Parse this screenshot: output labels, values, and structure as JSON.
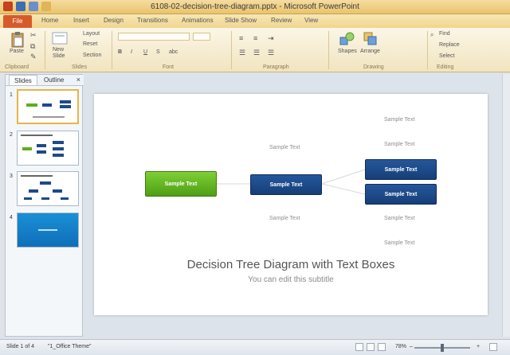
{
  "window": {
    "title": "6108-02-decision-tree-diagram.pptx - Microsoft PowerPoint"
  },
  "ribbon_tabs": [
    "File",
    "Home",
    "Insert",
    "Design",
    "Transitions",
    "Animations",
    "Slide Show",
    "Review",
    "View"
  ],
  "ribbon": {
    "paste": "Paste",
    "new_slide_line1": "New",
    "new_slide_line2": "Slide",
    "layout": "Layout",
    "reset": "Reset",
    "section": "Section",
    "shapes": "Shapes",
    "arrange": "Arrange",
    "find": "Find",
    "replace": "Replace",
    "select": "Select",
    "groups": {
      "clipboard": "Clipboard",
      "slides": "Slides",
      "font": "Font",
      "paragraph": "Paragraph",
      "drawing": "Drawing",
      "editing": "Editing"
    }
  },
  "panel": {
    "tab_slides": "Slides",
    "tab_outline": "Outline",
    "close": "×",
    "slide_numbers": [
      "1",
      "2",
      "3",
      "4"
    ]
  },
  "slide": {
    "root_box": "Sample Text",
    "mid_box": "Sample Text",
    "upper_label": "Sample Text",
    "lower_label": "Sample Text",
    "right_box_1": "Sample Text",
    "right_box_2": "Sample Text",
    "right_text_1": "Sample Text",
    "right_text_2": "Sample Text",
    "right_text_3": "Sample Text",
    "right_text_4": "Sample Text",
    "title": "Decision Tree Diagram  with Text Boxes",
    "subtitle": "You can edit this subtitle"
  },
  "status": {
    "slide_indicator": "Slide 1 of 4",
    "theme": "\"1_Office Theme\"",
    "zoom": "78%",
    "zoom_minus": "–",
    "zoom_plus": "+"
  },
  "colors": {
    "ribbon": "#f1e4bf",
    "file_tab": "#d75a2a",
    "box_green": "#5fae1e",
    "box_navy": "#1d4a8a"
  }
}
